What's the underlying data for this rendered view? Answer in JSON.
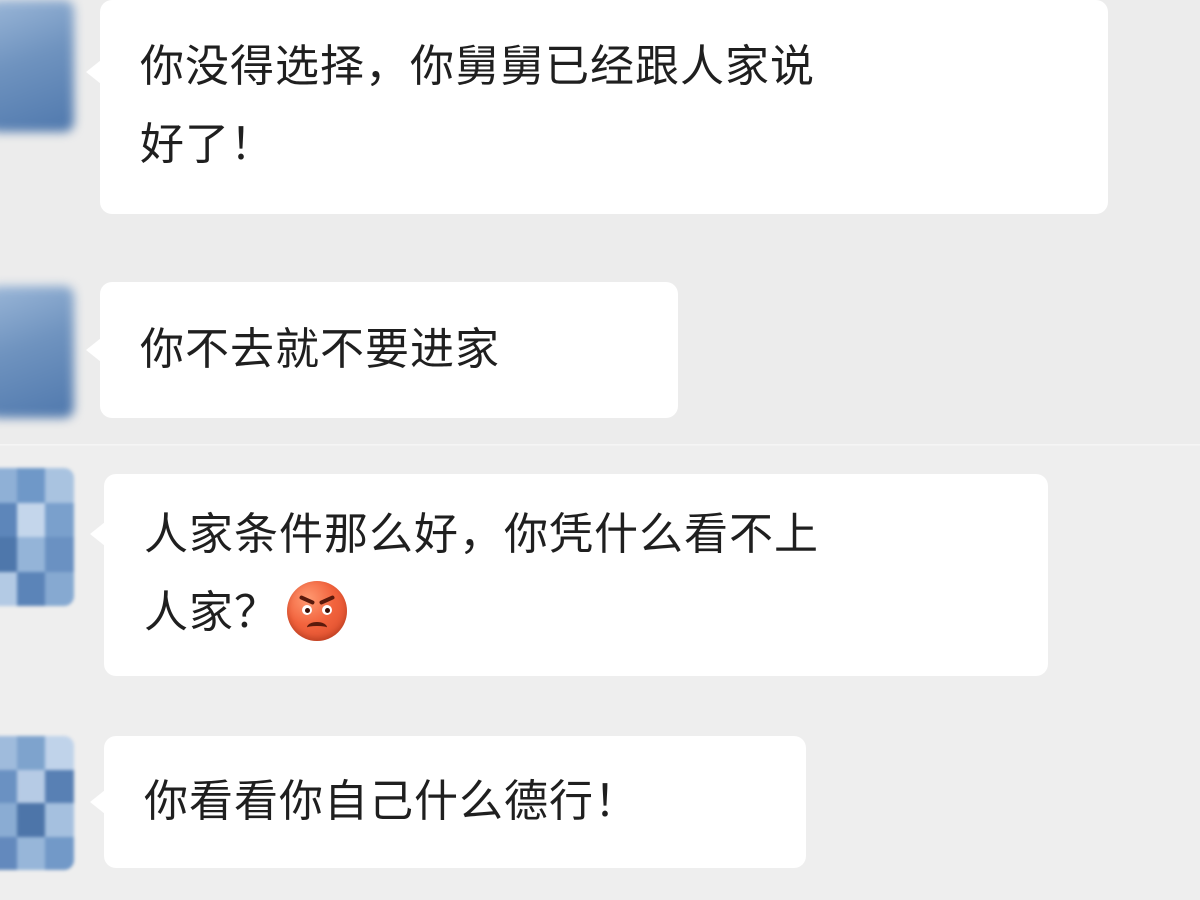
{
  "messages": [
    {
      "lines": [
        "你没得选择，你舅舅已经跟人家说",
        "好了！"
      ],
      "emoji": null
    },
    {
      "lines": [
        "你不去就不要进家"
      ],
      "emoji": null
    },
    {
      "lines": [
        "人家条件那么好，你凭什么看不上",
        "人家？"
      ],
      "emoji": "angry-face"
    },
    {
      "lines": [
        "你看看你自己什么德行！"
      ],
      "emoji": null
    }
  ],
  "colors": {
    "background": "#ededed",
    "bubble": "#ffffff",
    "text": "#1f1f1f",
    "avatar_blue": "#5a82b5"
  }
}
